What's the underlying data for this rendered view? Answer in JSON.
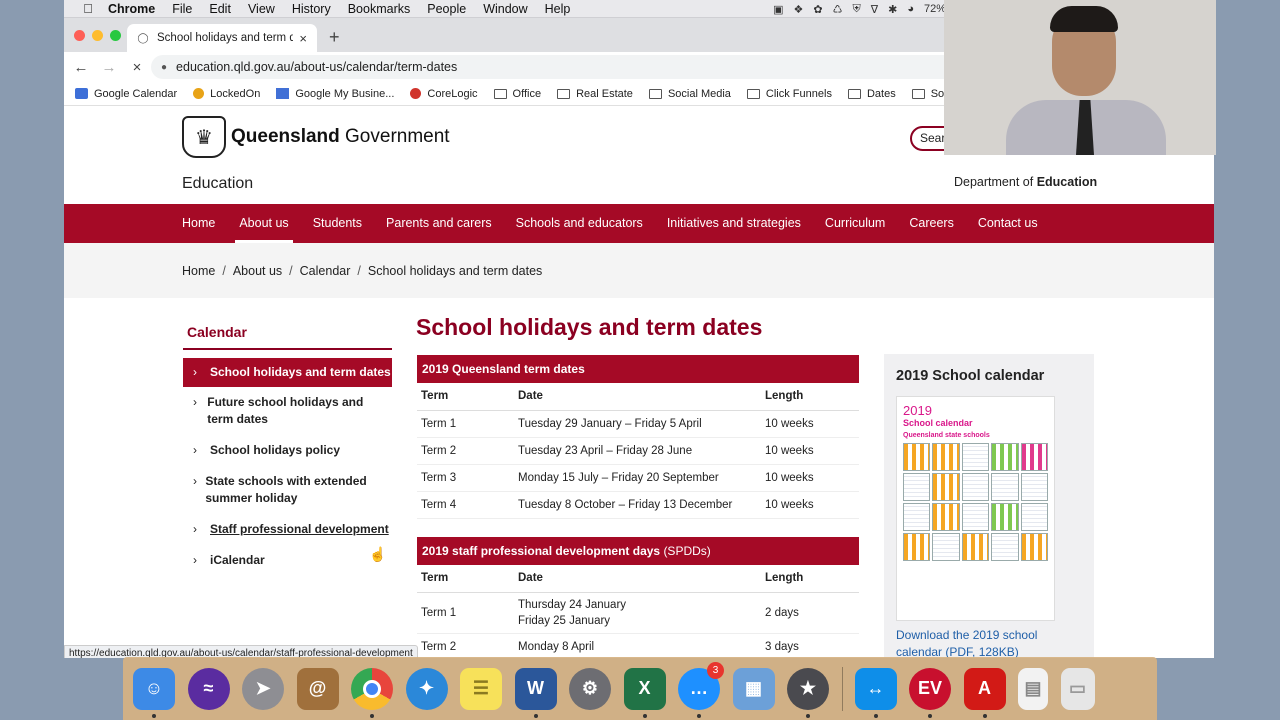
{
  "menubar": {
    "app": "Chrome",
    "items": [
      "File",
      "Edit",
      "View",
      "History",
      "Bookmarks",
      "People",
      "Window",
      "Help"
    ],
    "battery": "72%"
  },
  "browser": {
    "tab_title": "School holidays and term dates",
    "url": "education.qld.gov.au/about-us/calendar/term-dates",
    "bookmarks": [
      {
        "label": "Google Calendar",
        "icon": "calendar-icon"
      },
      {
        "label": "LockedOn",
        "icon": "lockedon-icon"
      },
      {
        "label": "Google My Busine...",
        "icon": "gmb-icon"
      },
      {
        "label": "CoreLogic",
        "icon": "corelogic-icon"
      },
      {
        "label": "Office",
        "icon": "folder-icon"
      },
      {
        "label": "Real Estate",
        "icon": "folder-icon"
      },
      {
        "label": "Social Media",
        "icon": "folder-icon"
      },
      {
        "label": "Click Funnels",
        "icon": "folder-icon"
      },
      {
        "label": "Dates",
        "icon": "folder-icon"
      },
      {
        "label": "Software",
        "icon": "folder-icon"
      }
    ],
    "status_url": "https://education.qld.gov.au/about-us/calendar/staff-professional-development"
  },
  "header": {
    "brand_bold": "Queensland",
    "brand_light": "Government",
    "search_label": "Search",
    "site_name": "Education",
    "dept_prefix": "Department of",
    "dept_bold": "Education"
  },
  "mainnav": [
    "Home",
    "About us",
    "Students",
    "Parents and carers",
    "Schools and educators",
    "Initiatives and strategies",
    "Curriculum",
    "Careers",
    "Contact us"
  ],
  "breadcrumb": [
    "Home",
    "About us",
    "Calendar",
    "School holidays and term dates"
  ],
  "sidenav": {
    "heading": "Calendar",
    "items": [
      "School holidays and term dates",
      "Future school holidays and term dates",
      "School holidays policy",
      "State schools with extended summer holiday",
      "Staff professional development",
      "iCalendar"
    ]
  },
  "main": {
    "title": "School holidays and term dates",
    "table1": {
      "title": "2019 Queensland term dates",
      "headers": [
        "Term",
        "Date",
        "Length"
      ],
      "rows": [
        [
          "Term 1",
          "Tuesday 29  January – Friday 5 April",
          "10 weeks"
        ],
        [
          "Term 2",
          "Tuesday 23 April – Friday 28 June",
          "10 weeks"
        ],
        [
          "Term 3",
          "Monday 15 July – Friday 20 September",
          "10 weeks"
        ],
        [
          "Term 4",
          "Tuesday 8 October – Friday 13 December",
          "10 weeks"
        ]
      ]
    },
    "table2": {
      "title": "2019 staff professional development days",
      "title_abbr": "(SPDDs)",
      "headers": [
        "Term",
        "Date",
        "Length"
      ],
      "rows": [
        [
          "Term 1",
          "Thursday 24 January",
          "Friday 25 January",
          "2 days"
        ],
        [
          "Term 2",
          "Monday 8 April",
          "3 days"
        ]
      ]
    }
  },
  "aside": {
    "heading": "2019 School calendar",
    "thumb_line1": "2019",
    "thumb_line2": "School calendar",
    "thumb_line3": "Queensland state schools",
    "download_link": "Download the 2019 school calendar (PDF, 128KB)"
  },
  "dock": {
    "apps": [
      {
        "name": "finder-icon",
        "color": "#3d8ae6"
      },
      {
        "name": "siri-icon",
        "color": "#5a2ca0"
      },
      {
        "name": "launchpad-icon",
        "color": "#8e8e93"
      },
      {
        "name": "contacts-icon",
        "color": "#a0703c"
      },
      {
        "name": "chrome-icon",
        "color": "#e8453c"
      },
      {
        "name": "safari-icon",
        "color": "#2b88d9"
      },
      {
        "name": "notes-icon",
        "color": "#f7e15a"
      },
      {
        "name": "word-icon",
        "color": "#2b579a"
      },
      {
        "name": "system-preferences-icon",
        "color": "#6d6d72"
      },
      {
        "name": "excel-icon",
        "color": "#217346"
      },
      {
        "name": "messages-icon",
        "color": "#1e90ff"
      },
      {
        "name": "preview-icon",
        "color": "#6ca0d8"
      },
      {
        "name": "imovie-icon",
        "color": "#4a4a4f"
      },
      {
        "name": "teamviewer-icon",
        "color": "#0e8ee9"
      },
      {
        "name": "ev-icon",
        "color": "#c8102e"
      },
      {
        "name": "acrobat-icon",
        "color": "#d21a16"
      },
      {
        "name": "document-icon",
        "color": "#f2f2f2"
      },
      {
        "name": "trash-icon",
        "color": "#e6e6e6"
      }
    ],
    "messages_badge": "3"
  }
}
